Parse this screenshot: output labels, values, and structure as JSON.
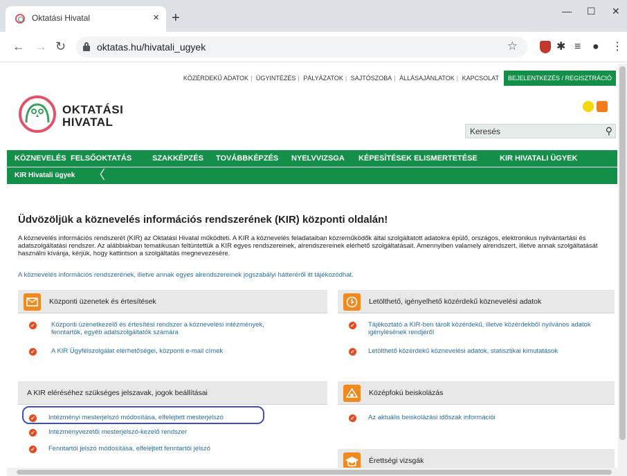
{
  "browser": {
    "tab_title": "Oktatási Hivatal",
    "tab_close": "×",
    "new_tab": "+",
    "window_controls": {
      "minimize": "—",
      "maximize": "☐",
      "close": "✕"
    },
    "nav": {
      "back": "←",
      "forward": "→",
      "reload": "↻"
    },
    "url": "oktatas.hu/hivatali_ugyek",
    "star": "☆",
    "ext_puzzle": "✱",
    "ext_playlist": "≡",
    "ext_profile": "●",
    "ext_menu": "⋮"
  },
  "topnav": {
    "links": [
      "KÖZÉRDEKŰ ADATOK",
      "ÜGYINTÉZÉS",
      "PÁLYÁZATOK",
      "SAJTÓSZOBA",
      "ÁLLÁSAJÁNLATOK",
      "KAPCSOLAT"
    ],
    "separator": "|",
    "login": "BEJELENTKEZÉS / REGISZTRÁCIÓ"
  },
  "logo": {
    "line1": "OKTATÁSI",
    "line2": "HIVATAL"
  },
  "search": {
    "placeholder": "Keresés",
    "icon": "⚲"
  },
  "mainnav": {
    "items": [
      "KÖZNEVELÉS",
      "FELSŐOKTATÁS",
      "SZAKKÉPZÉS",
      "TOVÁBBKÉPZÉS",
      "NYELVVIZSGA",
      "KÉPESÍTÉSEK ELISMERTETÉSE",
      "KIR HIVATALI ÜGYEK"
    ]
  },
  "subnav": {
    "label": "KIR Hivatali ügyek",
    "chevron": "〈"
  },
  "main": {
    "headline": "Üdvözöljük a köznevelés információs rendszerének (KIR) központi oldalán!",
    "intro": "A köznevelés információs rendszerét (KIR) az Oktatási Hivatal működteti. A KIR a köznevelés feladataiban közreműködők által szolgáltatott adatokra épülő, országos, elektronikus nyilvántartási és adatszolgáltatási rendszer. Az alábbiakban tematikusan feltüntettük a KIR egyes rendszereinek, alrendszereinek elérhető szolgáltatásait. Amennyiben valamely alrendszert, illetve annak szolgáltatását használni kívánja, kérjük, hogy kattintson a szolgáltatás megnevezésére.",
    "intro_link": "A köznevelés információs rendszerének, illetve annak egyes alrendszereinek jogszabályi hátteréről itt tájékozódhat."
  },
  "boxes": {
    "messages": {
      "title": "Központi üzenetek és értesítések",
      "items": [
        "Központi üzenetkezelő és értesítési rendszer a köznevelési intézmények, fenntartók, egyéb adatszolgáltatók számára",
        "A KIR Ügyfélszolgálat elérhetőségei, központi e-mail címek"
      ]
    },
    "public_data": {
      "title": "Letölthető, igényelhető közérdekű köznevelési adatok",
      "items": [
        "Tájékoztató a KIR-ben tárolt közérdekű, illetve közérdekből nyilvános adatok igénylésének rendjéről",
        "Letölthető közérdekű köznevelési adatok, statisztikai kimutatások"
      ]
    },
    "passwords": {
      "title": "A KIR eléréséhez szükséges jelszavak, jogok beállításai",
      "items": [
        "Intézményi mesterjelszó módosítása, elfelejtett mesterjelszó",
        "Intézményvezetői mesterjelszó-kezelő rendszer",
        "Fenntartói jelszó módosítása, elfelejtett fenntartói jelszó"
      ]
    },
    "secondary": {
      "title": "Középfokú beiskolázás",
      "items": [
        "Az aktuális beiskolázási időszak információi"
      ]
    },
    "matura": {
      "title": "Érettségi vizsgák"
    }
  },
  "colors": {
    "brand_green": "#148f4a",
    "link": "#2a6f9f",
    "check": "#e8491d",
    "icon_orange": "#f08a1e",
    "highlight": "#3f4fc2"
  }
}
